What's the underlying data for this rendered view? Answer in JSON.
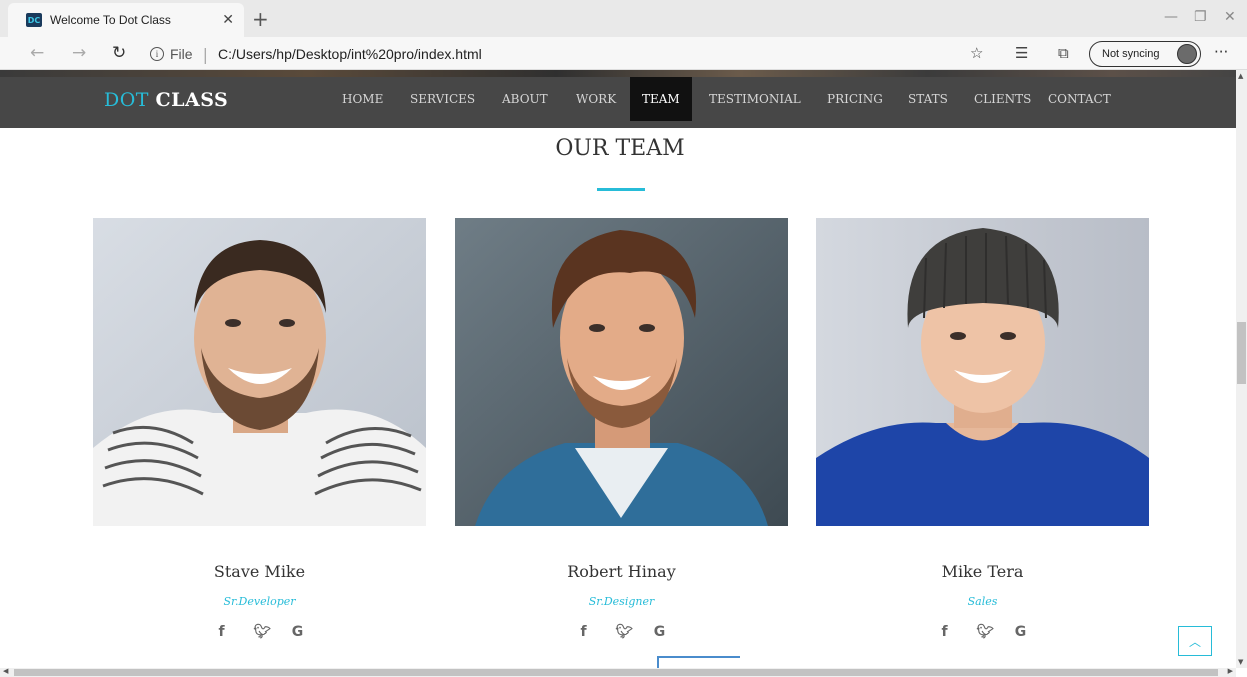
{
  "browser": {
    "tab_title": "Welcome To Dot Class",
    "tab_favicon": "DC",
    "url_scheme": "File",
    "url": "C:/Users/hp/Desktop/int%20pro/index.html",
    "sync_label": "Not syncing"
  },
  "navbar": {
    "brand_a": "DOT",
    "brand_b": "CLASS",
    "links": [
      "HOME",
      "SERVICES",
      "ABOUT",
      "WORK",
      "TEAM",
      "TESTIMONIAL",
      "PRICING",
      "STATS",
      "CLIENTS",
      "CONTACT"
    ],
    "active": "TEAM"
  },
  "team": {
    "title": "OUR TEAM",
    "members": [
      {
        "name": "Stave Mike",
        "role": "Sr.Developer"
      },
      {
        "name": "Robert Hinay",
        "role": "Sr.Designer"
      },
      {
        "name": "Mike Tera",
        "role": "Sales"
      }
    ],
    "social": [
      "f",
      "✉",
      "G"
    ]
  },
  "icons": {
    "back_to_top": "chevron-up-icon"
  },
  "colors": {
    "accent": "#27bcd8",
    "navbar_bg": "#474747",
    "active_nav_bg": "#111111"
  }
}
